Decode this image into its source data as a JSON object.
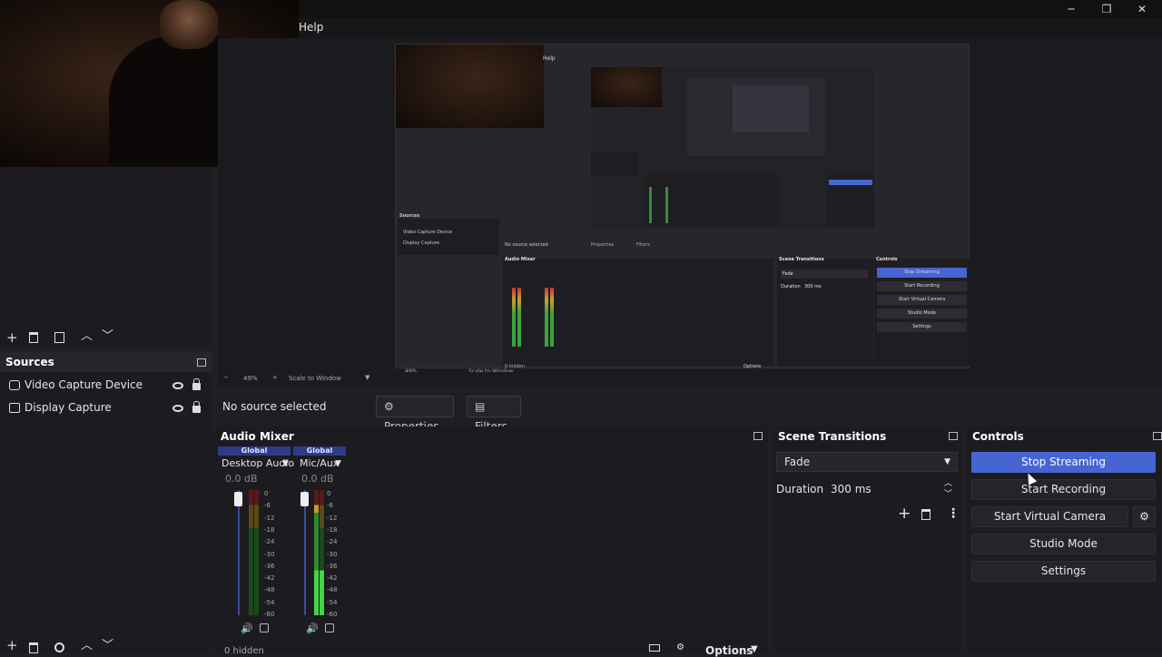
{
  "menu": {
    "help": "Help"
  },
  "window_controls": {
    "minimize": "─",
    "restore": "❐",
    "close": "✕"
  },
  "sources": {
    "title": "Sources",
    "items": [
      {
        "label": "Video Capture Device",
        "icon": "camera-icon"
      },
      {
        "label": "Display Capture",
        "icon": "monitor-icon"
      }
    ]
  },
  "source_bar": {
    "no_source": "No source selected",
    "properties": "Properties",
    "filters": "Filters"
  },
  "mixer": {
    "title": "Audio Mixer",
    "channels": [
      {
        "tag": "Global",
        "name": "Desktop Audio",
        "level": "0.0 dB",
        "level_fraction": 0.0
      },
      {
        "tag": "Global",
        "name": "Mic/Aux",
        "level": "0.0 dB",
        "level_fraction": 0.35
      }
    ],
    "scale": [
      "0",
      "-6",
      "-12",
      "-18",
      "-24",
      "-30",
      "-36",
      "-42",
      "-48",
      "-54",
      "-60"
    ],
    "hidden": "0 hidden",
    "options": "Options"
  },
  "transitions": {
    "title": "Scene Transitions",
    "selected": "Fade",
    "duration_label": "Duration",
    "duration_value": "300 ms"
  },
  "controls": {
    "title": "Controls",
    "stop_streaming": "Stop Streaming",
    "start_recording": "Start Recording",
    "start_virtual_camera": "Start Virtual Camera",
    "studio_mode": "Studio Mode",
    "settings": "Settings"
  },
  "nested": {
    "help": "Help",
    "sources": "Sources",
    "src1": "Video Capture Device",
    "src2": "Display Capture",
    "no_source": "No source selected",
    "properties": "Properties",
    "filters": "Filters",
    "mixer": "Audio Mixer",
    "transitions": "Scene Transitions",
    "fade": "Fade",
    "duration": "Duration",
    "duration_value": "300 ms",
    "controls": "Controls",
    "stop_streaming": "Stop Streaming",
    "start_recording": "Start Recording",
    "virtual_camera": "Start Virtual Camera",
    "studio_mode": "Studio Mode",
    "settings": "Settings",
    "zoom": "49%",
    "scale_mode": "Scale to Window",
    "options": "Options",
    "hidden": "0 hidden"
  },
  "colors": {
    "accent": "#4664d2",
    "bg": "#1f1f23",
    "panel": "#1c1c20"
  }
}
